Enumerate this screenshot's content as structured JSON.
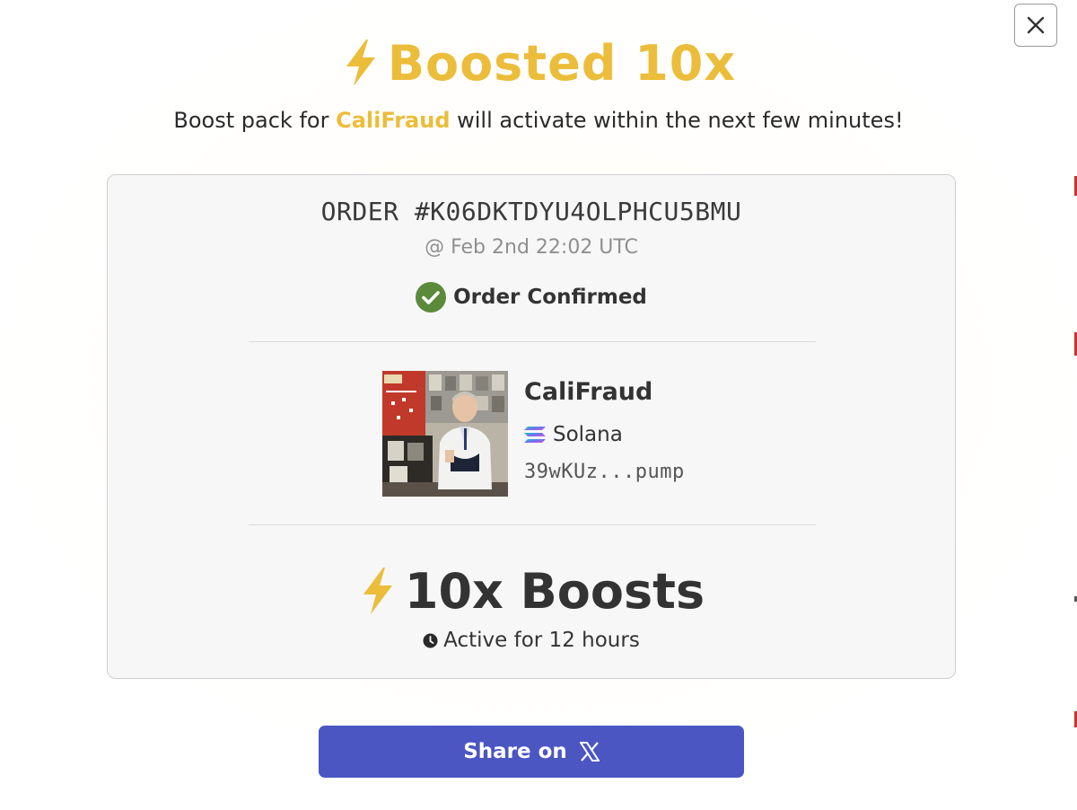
{
  "modal": {
    "title": "Boosted 10x",
    "subtitle_prefix": "Boost pack for ",
    "subtitle_token": "CaliFraud",
    "subtitle_suffix": " will activate within the next few minutes!"
  },
  "order": {
    "id": "ORDER #K06DKTDYU4OLPHCU5BMU",
    "timestamp": "@ Feb 2nd 22:02 UTC",
    "status": "Order Confirmed"
  },
  "token": {
    "name": "CaliFraud",
    "chain": "Solana",
    "address": "39wKUz...pump"
  },
  "boost": {
    "amount_label": "10x Boosts",
    "duration": "Active for 12 hours"
  },
  "share": {
    "label": "Share on"
  },
  "colors": {
    "accent_yellow": "#ebbd3a",
    "confirm_green": "#5a8a3a",
    "share_blue": "#4b56c2",
    "text_dark": "#333333"
  },
  "icons": {
    "title": "lightning-bolt-icon",
    "status": "check-circle-icon",
    "chain": "solana-icon",
    "duration": "clock-icon",
    "share": "x-logo-icon",
    "close": "close-icon"
  }
}
